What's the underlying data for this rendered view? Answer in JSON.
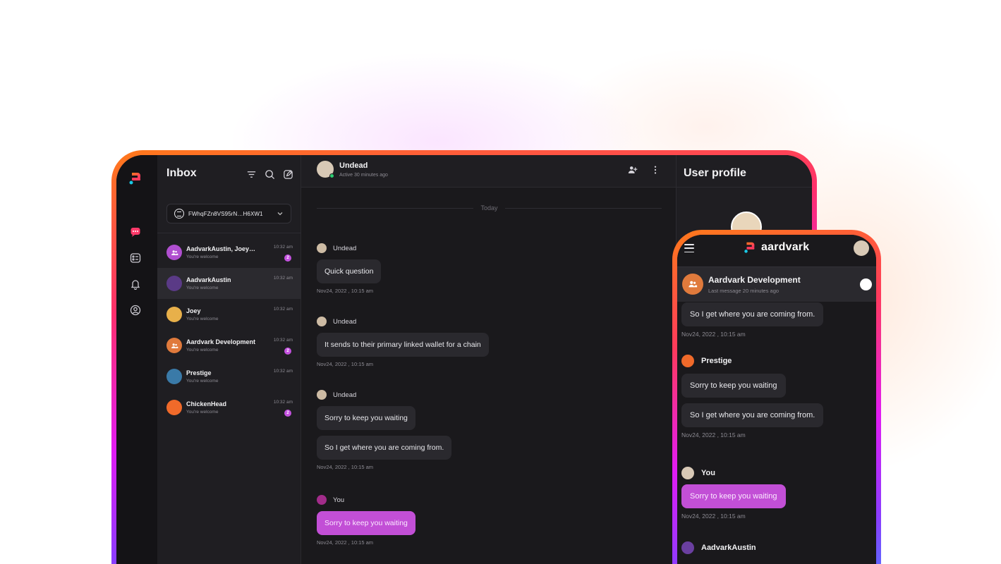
{
  "colors": {
    "accent": "#c24fd6",
    "background": "#1a191c",
    "frame_orange": "#ff7a1a",
    "frame_magenta": "#e11cf3",
    "frame_teal": "#00d4b0"
  },
  "rail": {
    "icons": [
      "chat-icon",
      "contacts-icon",
      "bell-icon",
      "profile-icon"
    ]
  },
  "inbox": {
    "title": "Inbox",
    "wallet": "FWhqFZn8VS95rN…H6XW1",
    "conversations": [
      {
        "name": "AadvarkAustin, Joey…",
        "preview": "You're welcome",
        "time": "10:32 am",
        "badge": "2",
        "avatar_color": "#b04fd0"
      },
      {
        "name": "AadvarkAustin",
        "preview": "You're welcome",
        "time": "10:32 am",
        "badge": "",
        "avatar_color": "#5a3a86"
      },
      {
        "name": "Joey",
        "preview": "You're welcome",
        "time": "10:32 am",
        "badge": "",
        "avatar_color": "#e8b04a"
      },
      {
        "name": "Aardvark Development",
        "preview": "You're welcome",
        "time": "10:32 am",
        "badge": "2",
        "avatar_color": "#e07a3c"
      },
      {
        "name": "Prestige",
        "preview": "You're welcome",
        "time": "10:32 am",
        "badge": "",
        "avatar_color": "#3a7aa8"
      },
      {
        "name": "ChickenHead",
        "preview": "You're welcome",
        "time": "10:32 am",
        "badge": "2",
        "avatar_color": "#f06a2a"
      }
    ]
  },
  "chat": {
    "name": "Undead",
    "status": "Active 30 minutes ago",
    "day_label": "Today",
    "messages": [
      {
        "sender": "Undead",
        "bubbles": [
          "Quick question"
        ],
        "time": "Nov24, 2022 , 10:15 am"
      },
      {
        "sender": "Undead",
        "bubbles": [
          "It sends to their primary linked wallet for a chain"
        ],
        "time": "Nov24, 2022 , 10:15 am"
      },
      {
        "sender": "Undead",
        "bubbles": [
          "Sorry to keep you waiting",
          "So I get where you are coming from."
        ],
        "time": "Nov24, 2022 , 10:15 am"
      },
      {
        "sender": "You",
        "bubbles": [
          "Sorry to keep you waiting"
        ],
        "time": "Nov24, 2022 , 10:15 am"
      }
    ]
  },
  "profile": {
    "title": "User profile"
  },
  "phone": {
    "brand": "aardvark",
    "conversation": {
      "name": "Aardvark Development",
      "sub": "Last message 20 minutes ago"
    },
    "top_bubble": "So I get where you are coming from.",
    "top_time": "Nov24, 2022 , 10:15 am",
    "prestige": {
      "sender": "Prestige",
      "bubbles": [
        "Sorry to keep you waiting",
        "So I get where you are coming from."
      ],
      "time": "Nov24, 2022 , 10:15 am"
    },
    "you": {
      "sender": "You",
      "bubble": "Sorry to keep you waiting",
      "time": "Nov24, 2022 , 10:15 am"
    },
    "last_sender": "AadvarkAustin"
  }
}
